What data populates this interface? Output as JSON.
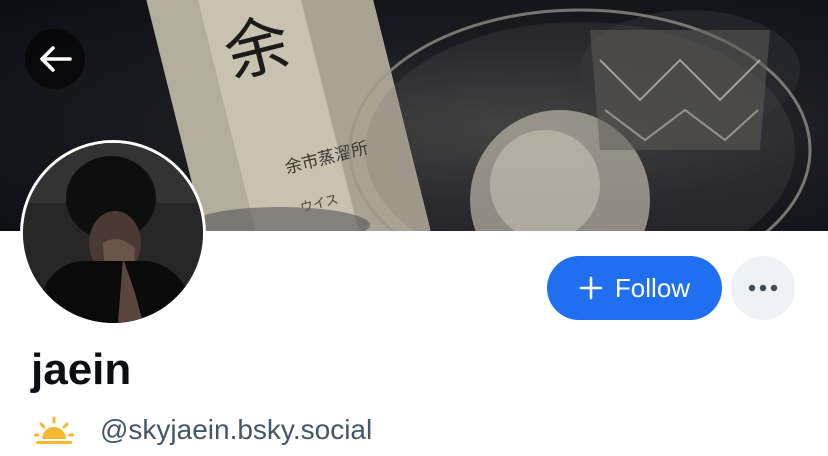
{
  "profile": {
    "display_name": "jaein",
    "handle": "@skyjaein.bsky.social",
    "handle_emoji_icon": "sunrise-icon"
  },
  "actions": {
    "follow_label": "Follow",
    "follow_icon": "plus-icon",
    "more_icon": "ellipsis-icon",
    "back_icon": "arrow-left-icon"
  },
  "banner": {
    "bottle_label_large": "余",
    "bottle_label_small": "余市蒸溜所",
    "bottle_label_sub": "ウイス"
  },
  "colors": {
    "accent": "#1f6ff0",
    "text_primary": "#0b0f14",
    "text_secondary": "#42576c",
    "more_button_bg": "#eef1f5"
  }
}
